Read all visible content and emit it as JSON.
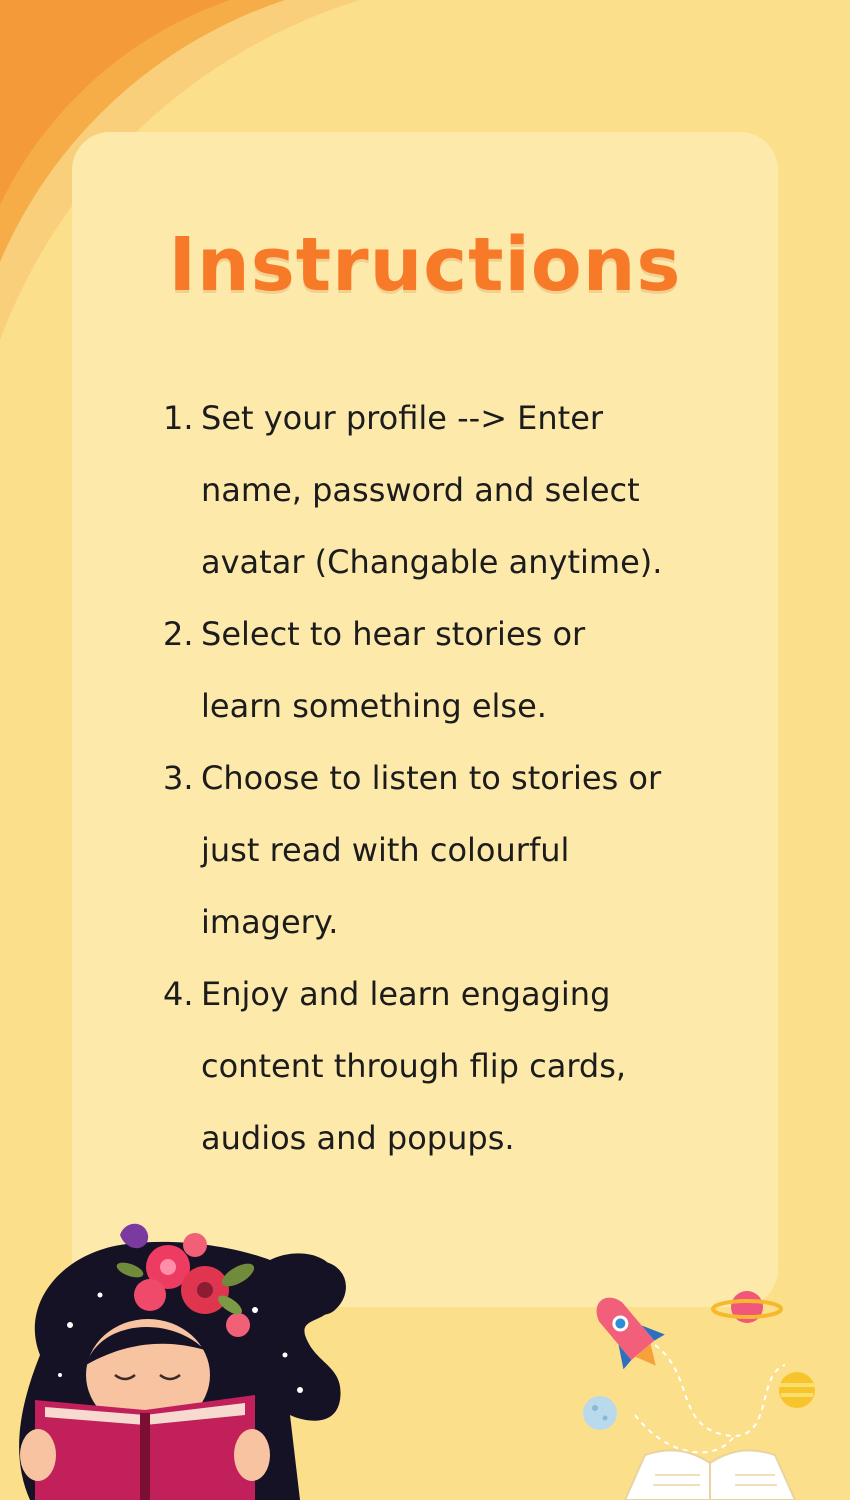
{
  "title": "Instructions",
  "steps": [
    {
      "number": "1.",
      "text": " Set your profile --> Enter\nname, password and select\navatar (Changable anytime)."
    },
    {
      "number": "2.",
      "text": " Select to hear stories or\nlearn something else."
    },
    {
      "number": "3.",
      "text": " Choose to listen to stories or\njust read with colourful\nimagery."
    },
    {
      "number": "4.",
      "text": " Enjoy and learn engaging\ncontent through flip cards,\naudios and popups."
    }
  ],
  "colors": {
    "background": "#fcdf8a",
    "card": "#fdeaab",
    "title": "#f77a28",
    "text": "#1c1c1c",
    "arc_outer": "#f49a38",
    "arc_inner": "#f8c66a"
  },
  "illustrations": {
    "girl": "girl-reading-book-illustration",
    "space": "rocket-planet-open-book-illustration"
  }
}
